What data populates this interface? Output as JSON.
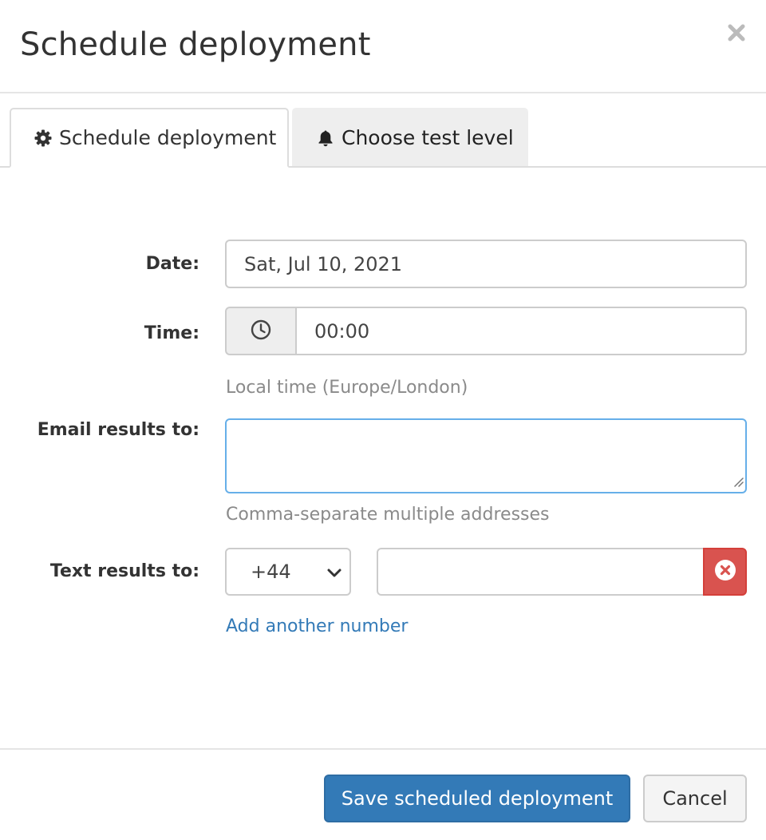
{
  "modal": {
    "title": "Schedule deployment",
    "close_symbol": "close-icon"
  },
  "tabs": [
    {
      "label": "Schedule deployment",
      "icon": "gear-icon",
      "active": true
    },
    {
      "label": "Choose test level",
      "icon": "bell-icon",
      "active": false
    }
  ],
  "form": {
    "date": {
      "label": "Date:",
      "value": "Sat, Jul 10, 2021"
    },
    "time": {
      "label": "Time:",
      "value": "00:00",
      "icon": "clock-icon",
      "help": "Local time (Europe/London)"
    },
    "email": {
      "label": "Email results to:",
      "value": "",
      "help": "Comma-separate multiple addresses"
    },
    "text": {
      "label": "Text results to:",
      "country_code": "+44",
      "phone_value": "",
      "remove_icon": "remove-circle-icon",
      "add_link": "Add another number"
    }
  },
  "footer": {
    "save_label": "Save scheduled deployment",
    "cancel_label": "Cancel"
  },
  "colors": {
    "primary": "#337ab7",
    "danger": "#d9534f",
    "focus_border": "#66afe9",
    "link": "#337ab7"
  }
}
